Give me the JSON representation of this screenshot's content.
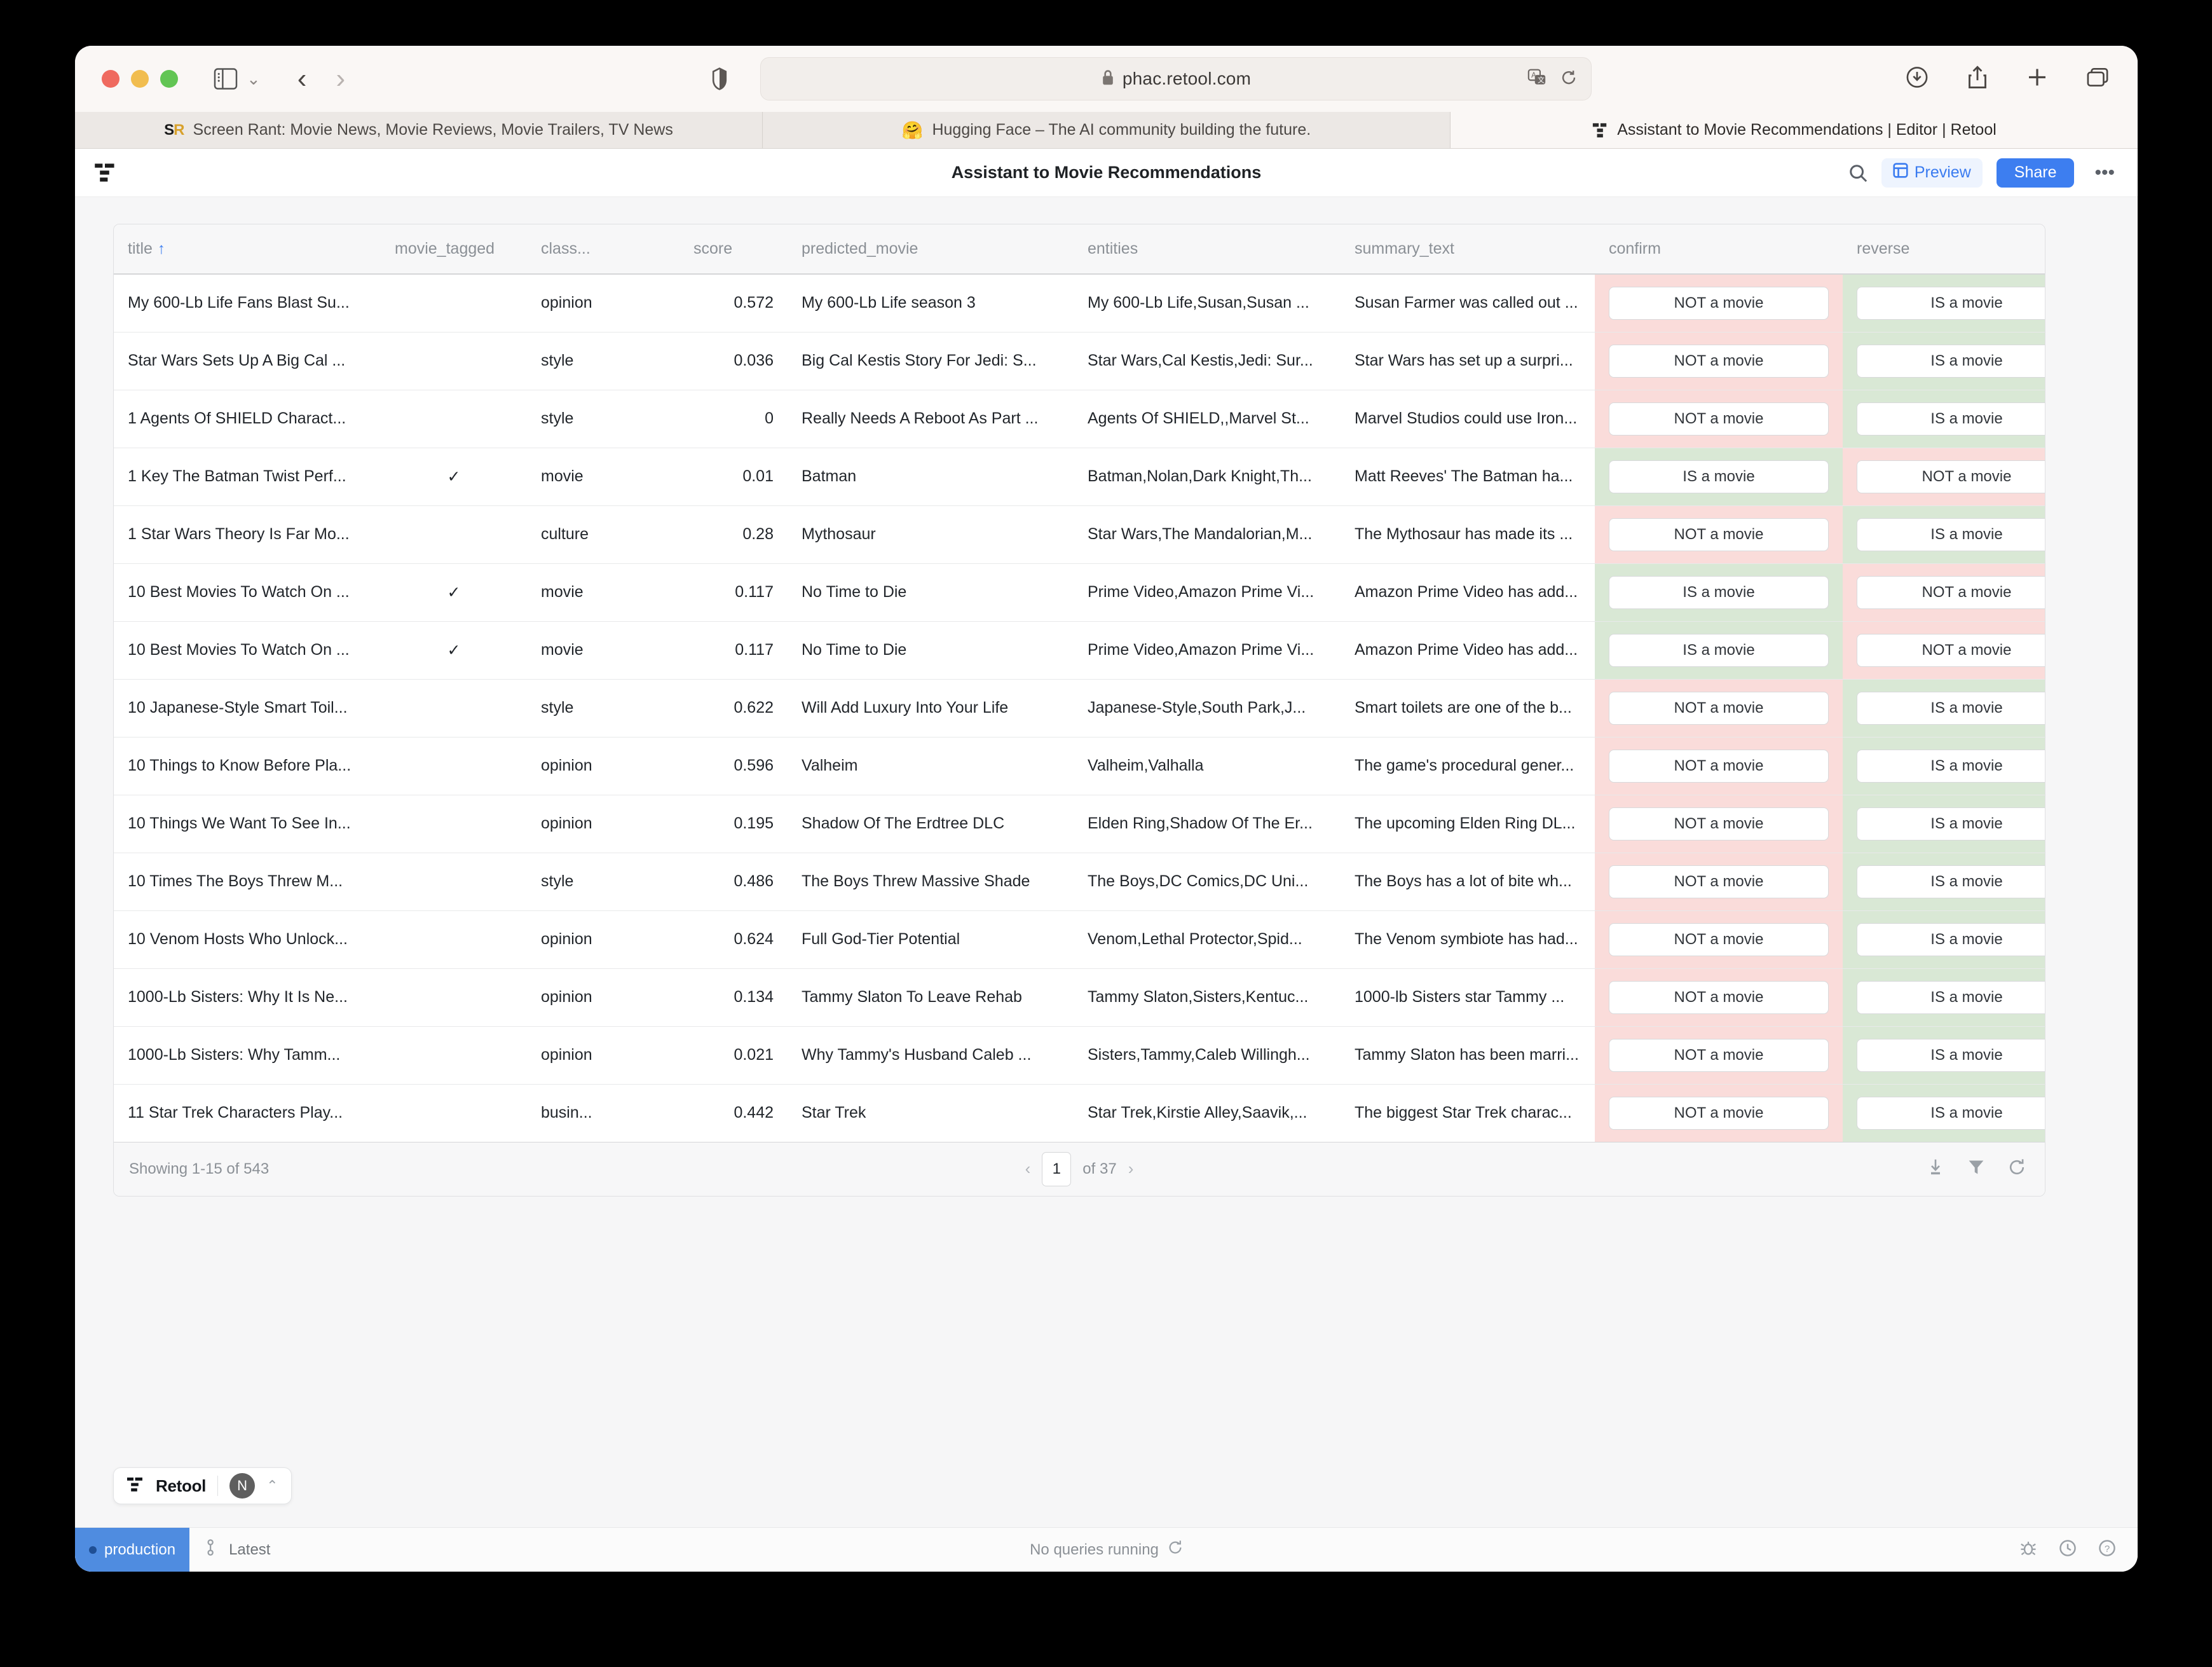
{
  "browser": {
    "url": "phac.retool.com",
    "lock_icon": "lock-icon",
    "tabs": [
      {
        "title": "Screen Rant: Movie News, Movie Reviews, Movie Trailers, TV News",
        "favicon": "screenrant-logo",
        "active": false
      },
      {
        "title": "Hugging Face – The AI community building the future.",
        "favicon": "hugging-face-emoji",
        "active": false
      },
      {
        "title": "Assistant to Movie Recommendations | Editor | Retool",
        "favicon": "retool-logo",
        "active": true
      }
    ]
  },
  "app": {
    "title": "Assistant to Movie Recommendations",
    "header_buttons": {
      "search": "search-icon",
      "preview": "Preview",
      "share": "Share",
      "more": "•••"
    }
  },
  "table": {
    "columns": [
      {
        "key": "title",
        "label": "title",
        "sorted": "asc"
      },
      {
        "key": "movie_tagged",
        "label": "movie_tagged"
      },
      {
        "key": "classification",
        "label": "class..."
      },
      {
        "key": "score",
        "label": "score"
      },
      {
        "key": "predicted_movie",
        "label": "predicted_movie"
      },
      {
        "key": "entities",
        "label": "entities"
      },
      {
        "key": "summary_text",
        "label": "summary_text"
      },
      {
        "key": "confirm",
        "label": "confirm"
      },
      {
        "key": "reverse",
        "label": "reverse"
      }
    ],
    "rows": [
      {
        "title": "My 600-Lb Life Fans Blast Su...",
        "movie_tagged": "",
        "classification": "opinion",
        "score": "0.572",
        "predicted_movie": "My 600-Lb Life season 3",
        "entities": "My 600-Lb Life,Susan,Susan ...",
        "summary_text": "Susan Farmer was called out ...",
        "confirm": "NOT a movie",
        "reverse": "IS a movie",
        "confirm_tone": "red",
        "reverse_tone": "green"
      },
      {
        "title": "Star Wars Sets Up A Big Cal ...",
        "movie_tagged": "",
        "classification": "style",
        "score": "0.036",
        "predicted_movie": "Big Cal Kestis Story For Jedi: S...",
        "entities": "Star Wars,Cal Kestis,Jedi: Sur...",
        "summary_text": "Star Wars has set up a surpri...",
        "confirm": "NOT a movie",
        "reverse": "IS a movie",
        "confirm_tone": "red",
        "reverse_tone": "green"
      },
      {
        "title": "1 Agents Of SHIELD Charact...",
        "movie_tagged": "",
        "classification": "style",
        "score": "0",
        "predicted_movie": "Really Needs A Reboot As Part ...",
        "entities": "Agents Of SHIELD,,Marvel St...",
        "summary_text": "Marvel Studios could use Iron...",
        "confirm": "NOT a movie",
        "reverse": "IS a movie",
        "confirm_tone": "red",
        "reverse_tone": "green"
      },
      {
        "title": "1 Key The Batman Twist Perf...",
        "movie_tagged": "✓",
        "classification": "movie",
        "score": "0.01",
        "predicted_movie": "Batman",
        "entities": "Batman,Nolan,Dark Knight,Th...",
        "summary_text": "Matt Reeves' The Batman ha...",
        "confirm": "IS a movie",
        "reverse": "NOT a movie",
        "confirm_tone": "green",
        "reverse_tone": "red"
      },
      {
        "title": "1 Star Wars Theory Is Far Mo...",
        "movie_tagged": "",
        "classification": "culture",
        "score": "0.28",
        "predicted_movie": "Mythosaur",
        "entities": "Star Wars,The Mandalorian,M...",
        "summary_text": "The Mythosaur has made its ...",
        "confirm": "NOT a movie",
        "reverse": "IS a movie",
        "confirm_tone": "red",
        "reverse_tone": "green"
      },
      {
        "title": "10 Best Movies To Watch On ...",
        "movie_tagged": "✓",
        "classification": "movie",
        "score": "0.117",
        "predicted_movie": "No Time to Die",
        "entities": "Prime Video,Amazon Prime Vi...",
        "summary_text": "Amazon Prime Video has add...",
        "confirm": "IS a movie",
        "reverse": "NOT a movie",
        "confirm_tone": "green",
        "reverse_tone": "red"
      },
      {
        "title": "10 Best Movies To Watch On ...",
        "movie_tagged": "✓",
        "classification": "movie",
        "score": "0.117",
        "predicted_movie": "No Time to Die",
        "entities": "Prime Video,Amazon Prime Vi...",
        "summary_text": "Amazon Prime Video has add...",
        "confirm": "IS a movie",
        "reverse": "NOT a movie",
        "confirm_tone": "green",
        "reverse_tone": "red"
      },
      {
        "title": "10 Japanese-Style Smart Toil...",
        "movie_tagged": "",
        "classification": "style",
        "score": "0.622",
        "predicted_movie": "Will Add Luxury Into Your Life",
        "entities": "Japanese-Style,South Park,J...",
        "summary_text": "Smart toilets are one of the b...",
        "confirm": "NOT a movie",
        "reverse": "IS a movie",
        "confirm_tone": "red",
        "reverse_tone": "green"
      },
      {
        "title": "10 Things to Know Before Pla...",
        "movie_tagged": "",
        "classification": "opinion",
        "score": "0.596",
        "predicted_movie": "Valheim",
        "entities": "Valheim,Valhalla",
        "summary_text": "The game's procedural gener...",
        "confirm": "NOT a movie",
        "reverse": "IS a movie",
        "confirm_tone": "red",
        "reverse_tone": "green"
      },
      {
        "title": "10 Things We Want To See In...",
        "movie_tagged": "",
        "classification": "opinion",
        "score": "0.195",
        "predicted_movie": "Shadow Of The Erdtree DLC",
        "entities": "Elden Ring,Shadow Of The Er...",
        "summary_text": "The upcoming Elden Ring DL...",
        "confirm": "NOT a movie",
        "reverse": "IS a movie",
        "confirm_tone": "red",
        "reverse_tone": "green"
      },
      {
        "title": "10 Times The Boys Threw M...",
        "movie_tagged": "",
        "classification": "style",
        "score": "0.486",
        "predicted_movie": "The Boys Threw Massive Shade",
        "entities": "The Boys,DC Comics,DC Uni...",
        "summary_text": "The Boys has a lot of bite wh...",
        "confirm": "NOT a movie",
        "reverse": "IS a movie",
        "confirm_tone": "red",
        "reverse_tone": "green"
      },
      {
        "title": "10 Venom Hosts Who Unlock...",
        "movie_tagged": "",
        "classification": "opinion",
        "score": "0.624",
        "predicted_movie": "Full God-Tier Potential",
        "entities": "Venom,Lethal Protector,Spid...",
        "summary_text": "The Venom symbiote has had...",
        "confirm": "NOT a movie",
        "reverse": "IS a movie",
        "confirm_tone": "red",
        "reverse_tone": "green"
      },
      {
        "title": "1000-Lb Sisters: Why It Is Ne...",
        "movie_tagged": "",
        "classification": "opinion",
        "score": "0.134",
        "predicted_movie": "Tammy Slaton To Leave Rehab",
        "entities": "Tammy Slaton,Sisters,Kentuc...",
        "summary_text": "1000-lb Sisters star Tammy ...",
        "confirm": "NOT a movie",
        "reverse": "IS a movie",
        "confirm_tone": "red",
        "reverse_tone": "green"
      },
      {
        "title": "1000-Lb Sisters: Why Tamm...",
        "movie_tagged": "",
        "classification": "opinion",
        "score": "0.021",
        "predicted_movie": "Why Tammy's Husband Caleb ...",
        "entities": "Sisters,Tammy,Caleb Willingh...",
        "summary_text": "Tammy Slaton has been marri...",
        "confirm": "NOT a movie",
        "reverse": "IS a movie",
        "confirm_tone": "red",
        "reverse_tone": "green"
      },
      {
        "title": "11 Star Trek Characters Play...",
        "movie_tagged": "",
        "classification": "busin...",
        "score": "0.442",
        "predicted_movie": "Star Trek",
        "entities": "Star Trek,Kirstie Alley,Saavik,...",
        "summary_text": "The biggest Star Trek charac...",
        "confirm": "NOT a movie",
        "reverse": "IS a movie",
        "confirm_tone": "red",
        "reverse_tone": "green"
      }
    ],
    "footer": {
      "showing": "Showing 1-15 of 543",
      "page_value": "1",
      "page_of": "of 37",
      "prev": "‹",
      "next": "›"
    }
  },
  "retool_pill": {
    "label": "Retool",
    "avatar": "N",
    "chevron": "chevron-up-icon"
  },
  "statusbar": {
    "environment": "production",
    "branch": "Latest",
    "queries": "No queries running"
  },
  "colors": {
    "accent": "#3d7ef0",
    "share_bg": "#3d7ef0",
    "row_red": "#fadcda",
    "row_green": "#d9e8d5",
    "env_badge": "#4f8ce0"
  }
}
